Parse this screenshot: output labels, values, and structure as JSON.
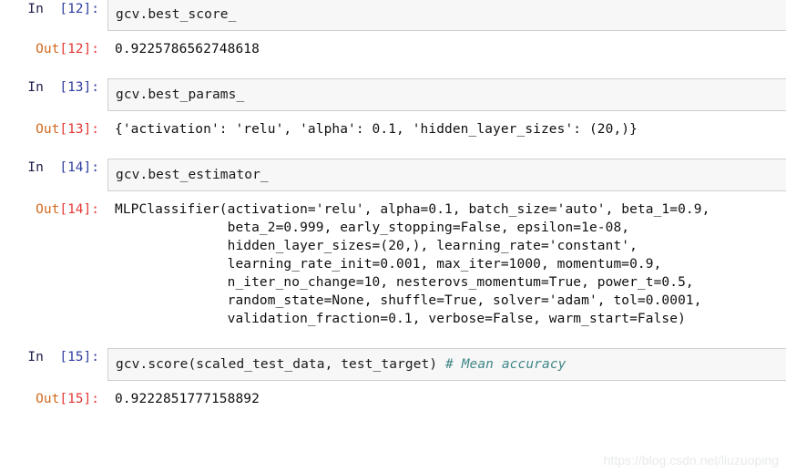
{
  "notebook": {
    "watermark": "https://blog.csdn.net/liuzuoping",
    "prompt_labels": {
      "in": "In  ",
      "out": "Out"
    },
    "cells": [
      {
        "execution_count": "[12]:",
        "in_label": "In  ",
        "out_label": "Out",
        "source": "gcv.best_score_",
        "comment": "",
        "output": "0.9225786562748618"
      },
      {
        "execution_count": "[13]:",
        "in_label": "In  ",
        "out_label": "Out",
        "source": "gcv.best_params_",
        "comment": "",
        "output": "{'activation': 'relu', 'alpha': 0.1, 'hidden_layer_sizes': (20,)}"
      },
      {
        "execution_count": "[14]:",
        "in_label": "In  ",
        "out_label": "Out",
        "source": "gcv.best_estimator_",
        "comment": "",
        "output": "MLPClassifier(activation='relu', alpha=0.1, batch_size='auto', beta_1=0.9,\n              beta_2=0.999, early_stopping=False, epsilon=1e-08,\n              hidden_layer_sizes=(20,), learning_rate='constant',\n              learning_rate_init=0.001, max_iter=1000, momentum=0.9,\n              n_iter_no_change=10, nesterovs_momentum=True, power_t=0.5,\n              random_state=None, shuffle=True, solver='adam', tol=0.0001,\n              validation_fraction=0.1, verbose=False, warm_start=False)"
      },
      {
        "execution_count": "[15]:",
        "in_label": "In  ",
        "out_label": "Out",
        "source": "gcv.score(scaled_test_data, test_target) ",
        "comment": "# Mean accuracy",
        "output": "0.9222851777158892"
      }
    ]
  }
}
